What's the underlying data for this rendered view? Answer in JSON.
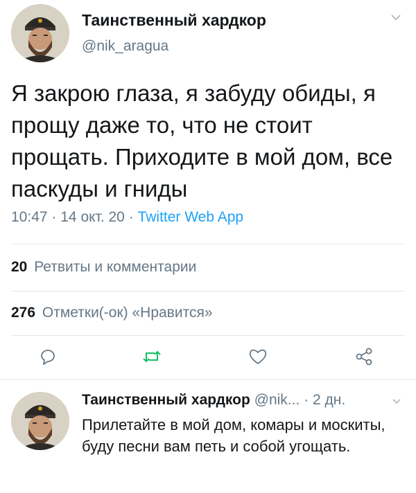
{
  "tweet": {
    "author_name": "Таинственный хардкор",
    "author_handle": "@nik_aragua",
    "text": "Я закрою глаза, я забуду обиды, я прощу даже то, что не стоит прощать. Приходите в мой дом, все паскуды и гниды",
    "time": "10:47",
    "separator": "·",
    "date": "14 окт. 20",
    "source": "Twitter Web App",
    "retweets_count": "20",
    "retweets_label": "Ретвиты и комментарии",
    "likes_count": "276",
    "likes_label": "Отметки(-ок) «Нравится»"
  },
  "actions": {
    "reply_icon": "comment-bubble",
    "retweet_icon": "retweet-arrows",
    "like_icon": "heart",
    "share_icon": "share-nodes",
    "retweet_color": "#17bf63",
    "icon_color": "#657786"
  },
  "reply": {
    "author_name": "Таинственный хардкор",
    "author_handle": "@nik...",
    "separator": "·",
    "time": "2 дн.",
    "text": "Прилетайте в мой дом, комары и москиты, буду песни вам петь и собой угощать."
  },
  "colors": {
    "link": "#1da1f2",
    "secondary_text": "#657786",
    "divider": "#e1e8ed"
  }
}
